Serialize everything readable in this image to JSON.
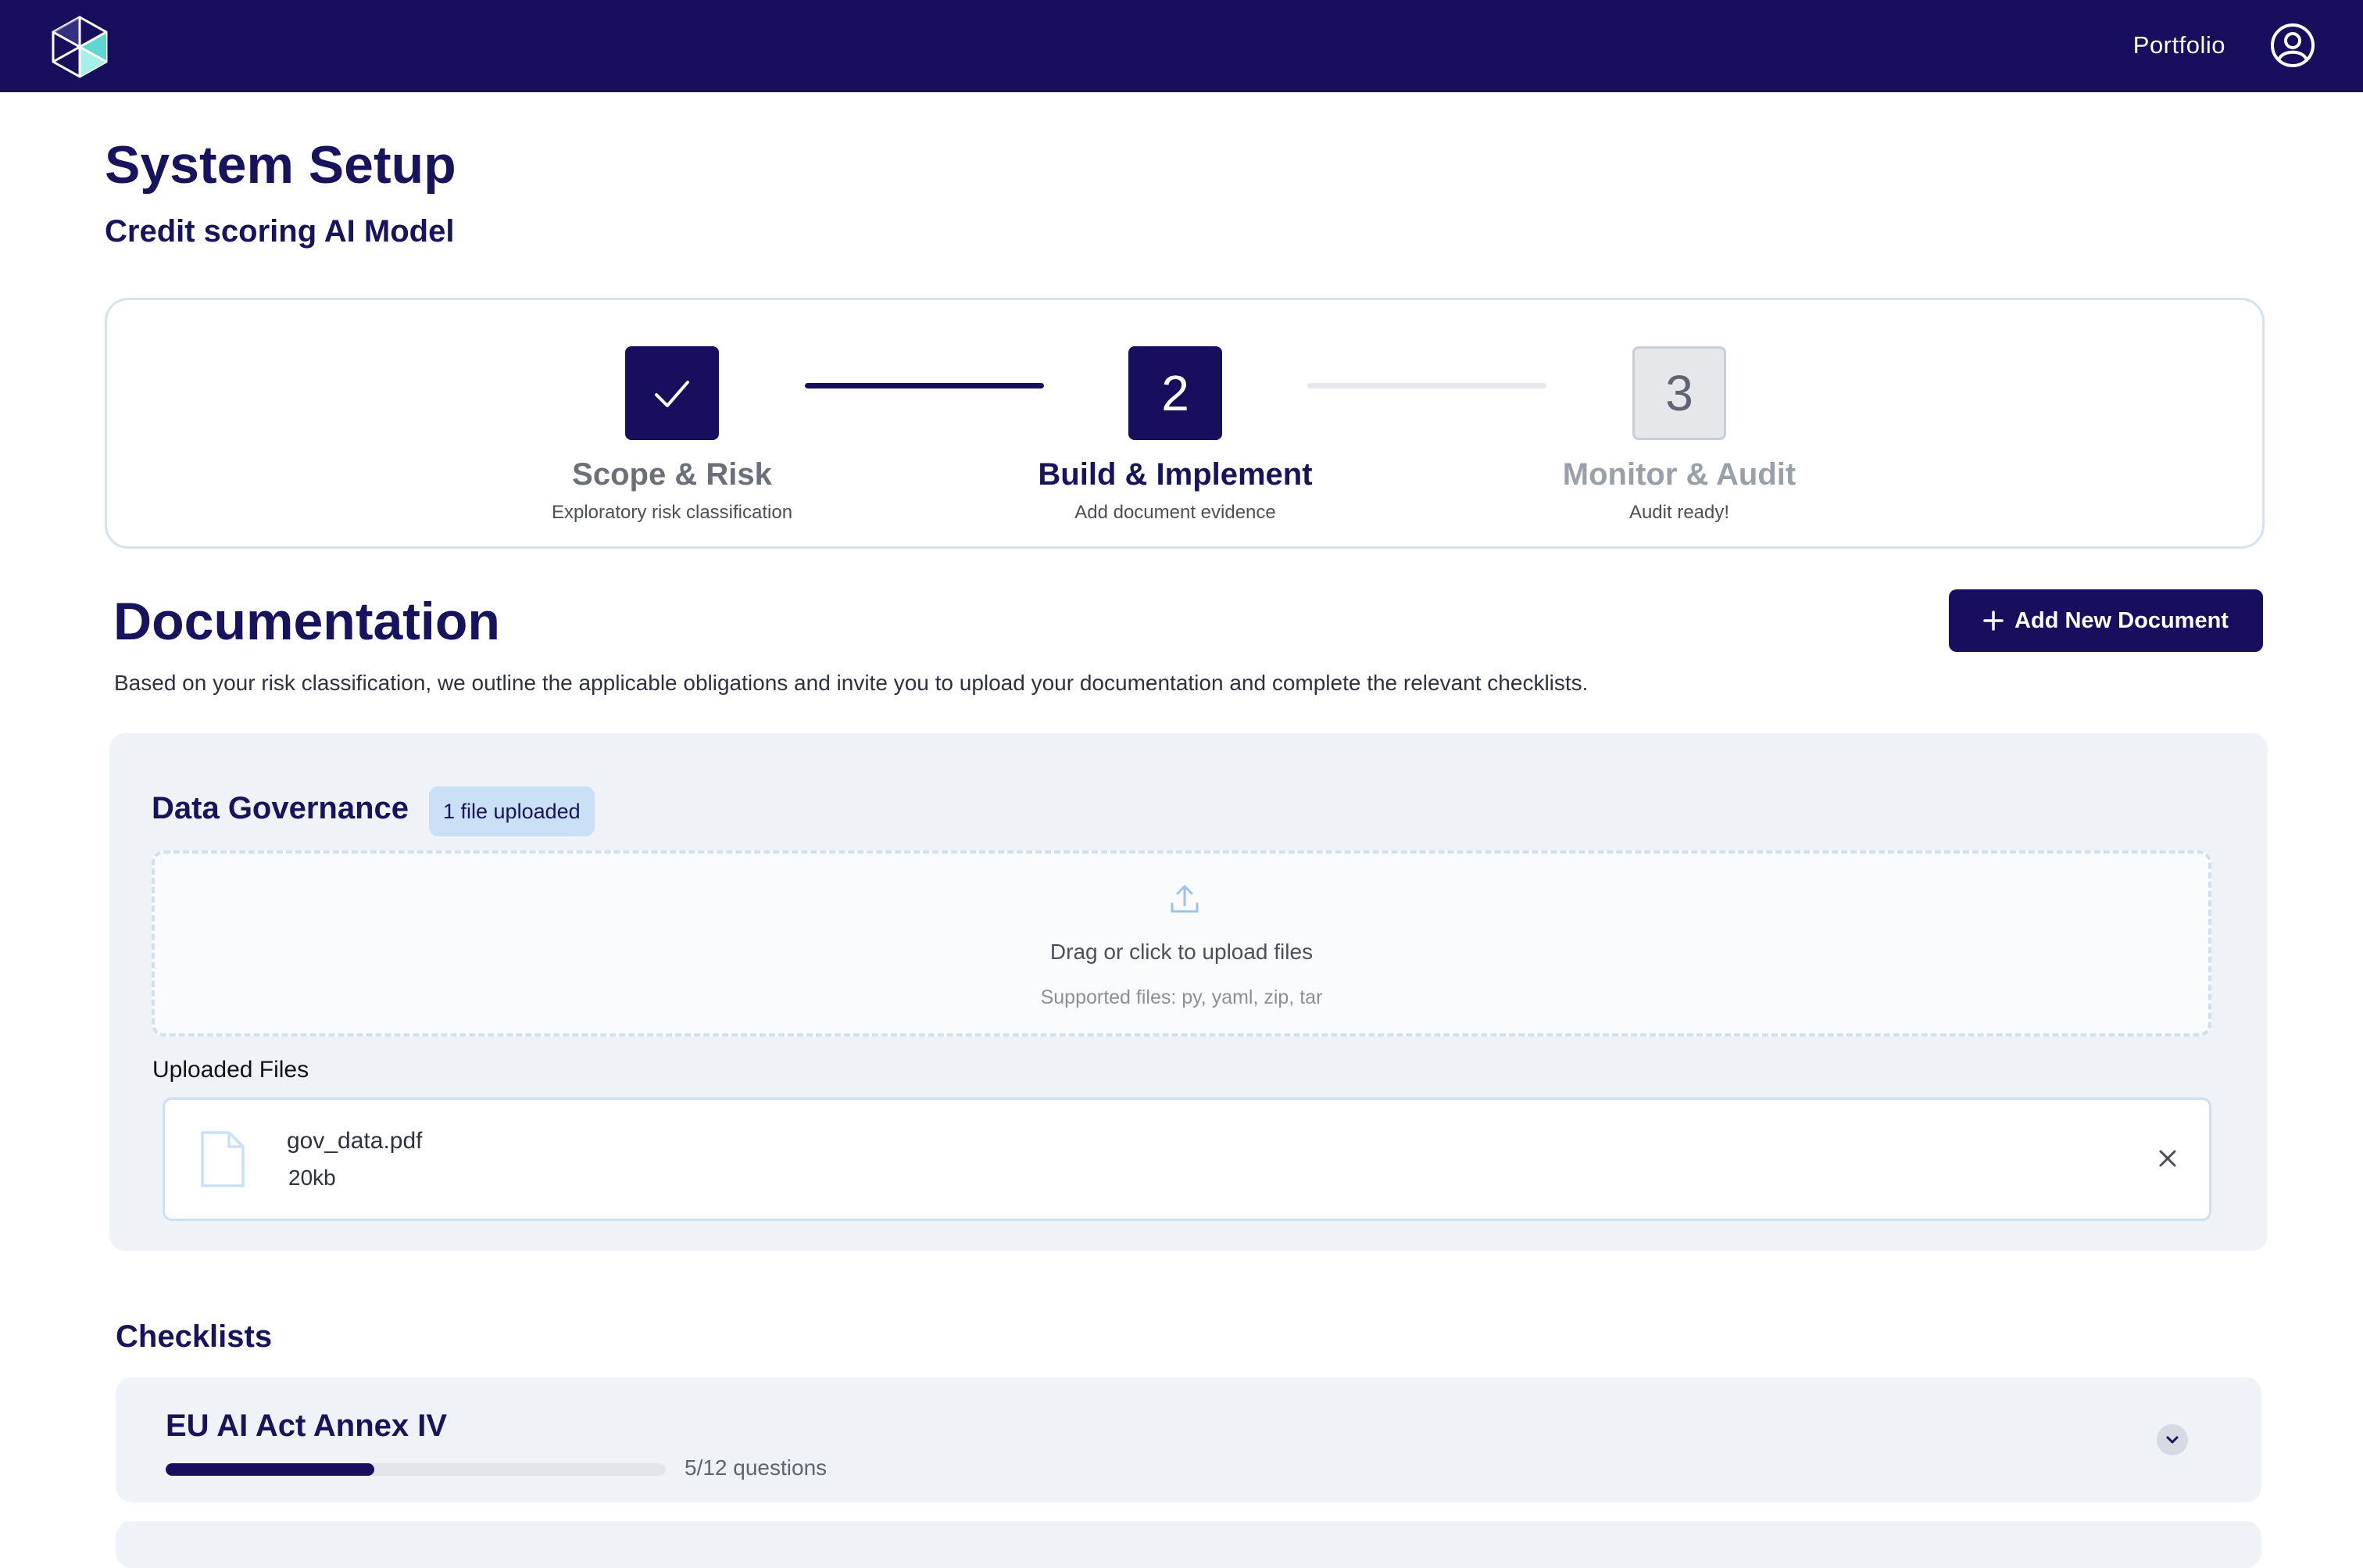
{
  "header": {
    "nav_label": "Portfolio",
    "brand_color": "#170e5e"
  },
  "page": {
    "title": "System Setup",
    "subtitle": "Credit scoring AI Model"
  },
  "stepper": {
    "steps": [
      {
        "number": "",
        "title": "Scope & Risk",
        "description": "Exploratory risk classification",
        "state": "completed"
      },
      {
        "number": "2",
        "title": "Build & Implement",
        "description": "Add document evidence",
        "state": "active"
      },
      {
        "number": "3",
        "title": "Monitor & Audit",
        "description": "Audit ready!",
        "state": "pending"
      }
    ]
  },
  "documentation": {
    "title": "Documentation",
    "add_button_label": "Add New Document",
    "description": "Based on your risk classification, we outline the applicable obligations and invite you to upload your documentation and complete the relevant checklists."
  },
  "data_governance": {
    "title": "Data Governance",
    "badge": "1 file uploaded",
    "dropzone_text": "Drag or click to upload files",
    "dropzone_supported": "Supported files: py, yaml, zip, tar",
    "uploaded_label": "Uploaded Files",
    "files": [
      {
        "name": "gov_data.pdf",
        "size": "20kb"
      }
    ]
  },
  "checklists": {
    "title": "Checklists",
    "items": [
      {
        "title": "EU AI Act Annex IV",
        "progress_text": "5/12 questions",
        "answered": 5,
        "total": 12
      }
    ]
  }
}
